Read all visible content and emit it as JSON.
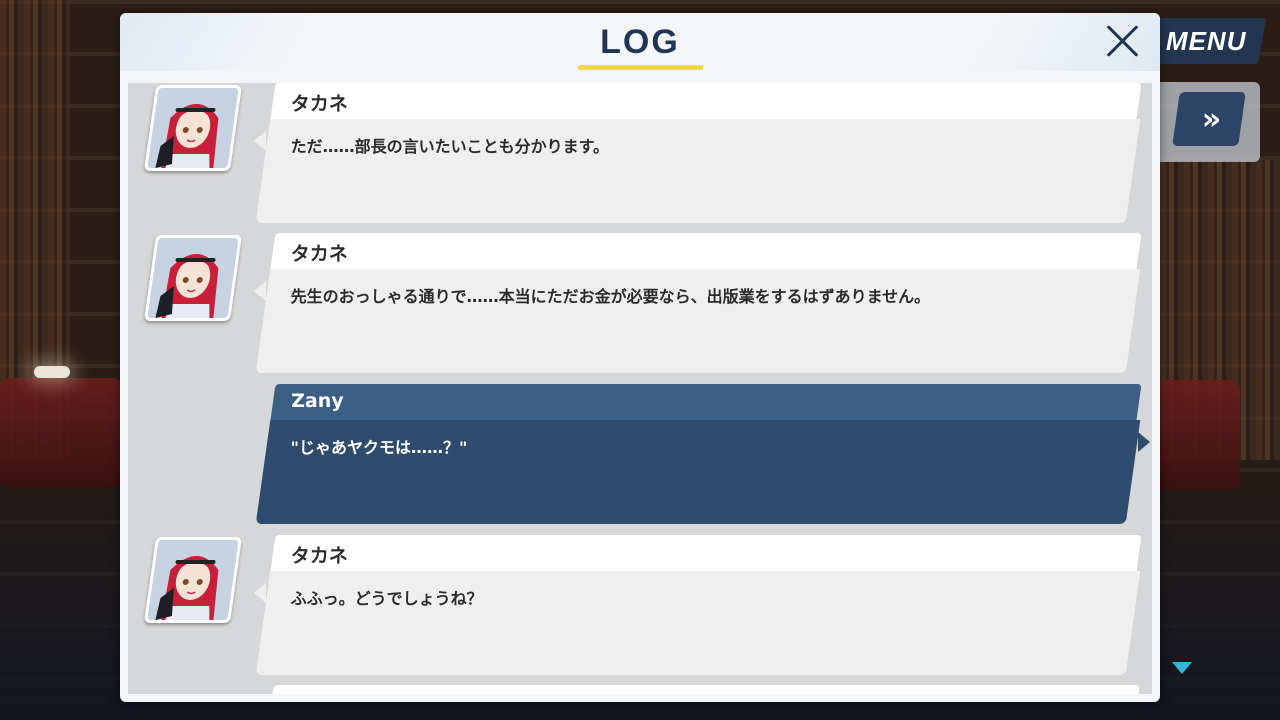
{
  "log_panel": {
    "title": "LOG",
    "close_icon": "close-x-icon",
    "entries": [
      {
        "speaker": "タカネ",
        "text": "ただ……部長の言いたいことも分かります。",
        "is_player": false,
        "portrait": "takane-portrait"
      },
      {
        "speaker": "タカネ",
        "text": "先生のおっしゃる通りで……本当にただお金が必要なら、出版業をするはずありません。",
        "is_player": false,
        "portrait": "takane-portrait"
      },
      {
        "speaker": "Zany",
        "text": "\"じゃあヤクモは……？\"",
        "is_player": true
      },
      {
        "speaker": "タカネ",
        "text": "ふふっ。どうでしょうね？",
        "is_player": false,
        "portrait": "takane-portrait"
      }
    ]
  },
  "hud": {
    "menu_label": "MENU",
    "fast_forward_label": "»",
    "scroll_indicator_icon": "triangle-down-icon"
  },
  "colors": {
    "title": "#1f3553",
    "underline": "#f2e12a",
    "player_name_bg": "#3d5f86",
    "player_body_bg": "#2f4b6d",
    "npc_body_bg": "#efefef",
    "menu_bg": "#23364f"
  }
}
